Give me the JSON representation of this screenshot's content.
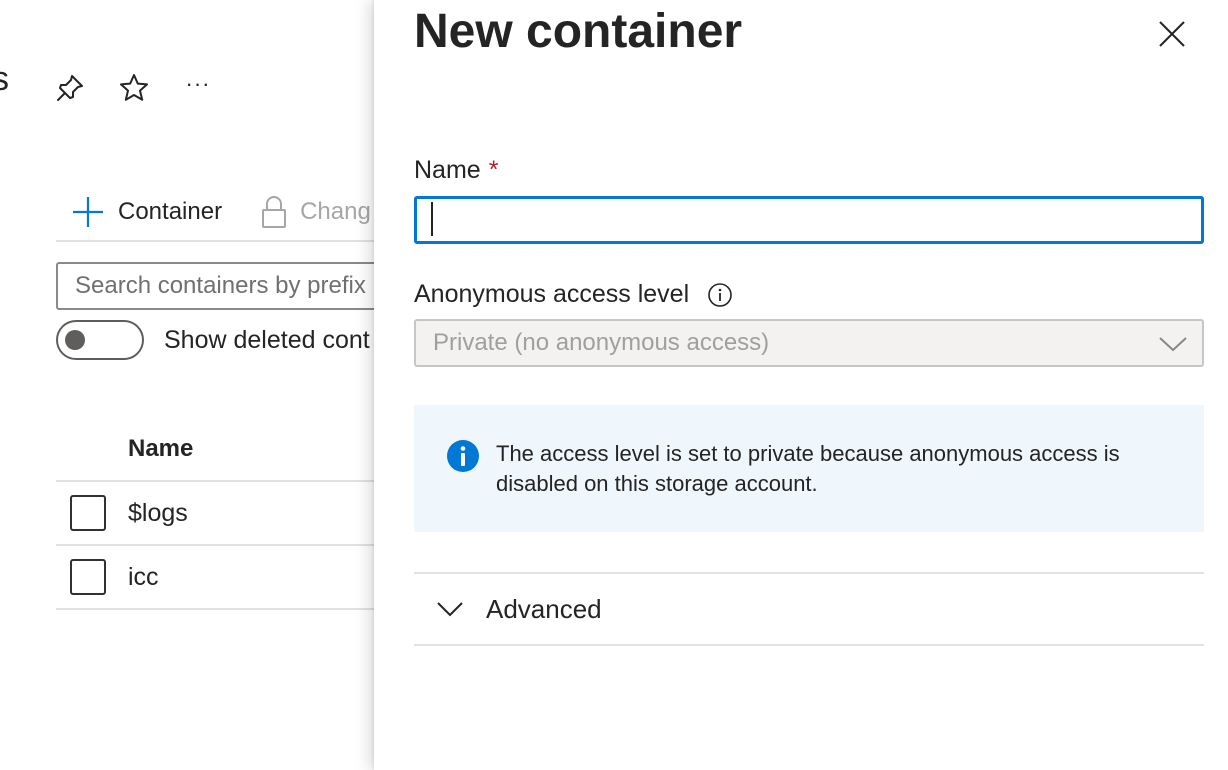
{
  "background": {
    "title_fragment": "s",
    "header_icons": [
      "pin-icon",
      "star-icon",
      "more-icon"
    ],
    "more_label": "···",
    "toolbar": {
      "add_container_label": "Container",
      "change_access_label": "Chang"
    },
    "search": {
      "placeholder": "Search containers by prefix"
    },
    "show_deleted_label": "Show deleted cont",
    "table": {
      "header_name": "Name",
      "rows": [
        {
          "name": "$logs"
        },
        {
          "name": "icc"
        }
      ]
    }
  },
  "panel": {
    "title": "New container",
    "name_field": {
      "label": "Name",
      "required_mark": "*",
      "value": ""
    },
    "access_level": {
      "label": "Anonymous access level",
      "value": "Private (no anonymous access)"
    },
    "info_message": "The access level is set to private because anonymous access is disabled on this storage account.",
    "advanced_label": "Advanced"
  },
  "colors": {
    "accent": "#0078d4",
    "required": "#a4262c",
    "info_background": "#eff6fc",
    "disabled_background": "#f3f2f1"
  }
}
